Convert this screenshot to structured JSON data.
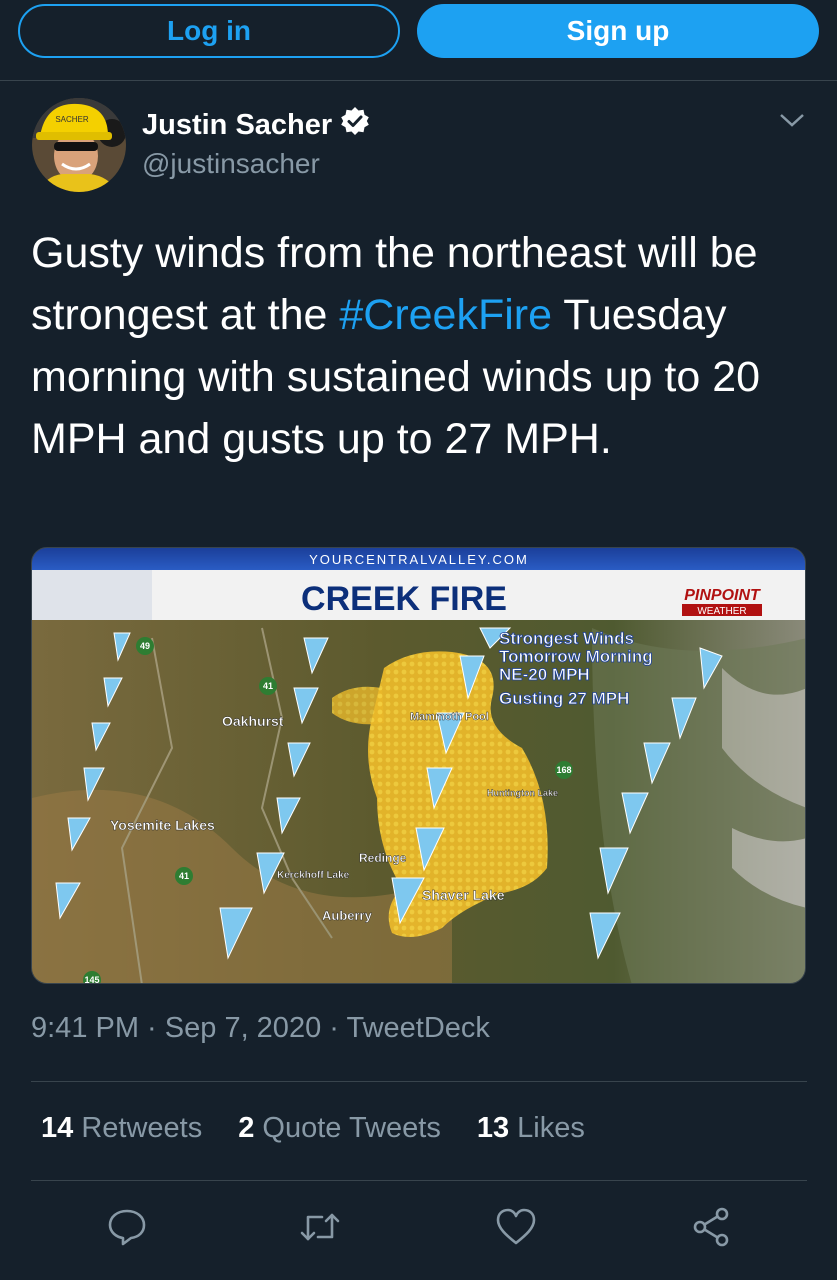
{
  "auth": {
    "login_label": "Log in",
    "signup_label": "Sign up"
  },
  "author": {
    "name": "Justin Sacher",
    "handle": "@justinsacher",
    "verified_icon": "verified-badge-icon",
    "avatar_helmet_text": "SACHER"
  },
  "tweet": {
    "text_before": "Gusty winds from the northeast will be strongest at the ",
    "hashtag": "#CreekFire",
    "text_after": " Tuesday morning with sustained winds up to 20 MPH and gusts up to 27 MPH."
  },
  "media": {
    "site": "YOURCENTRALVALLEY.COM",
    "title": "CREEK FIRE",
    "brand": "PINPOINT",
    "brand_sub": "WEATHER",
    "callout": [
      "Strongest Winds",
      "Tomorrow Morning",
      "NE-20 MPH",
      "Gusting 27 MPH"
    ],
    "places": {
      "oakhurst": "Oakhurst",
      "yosemite_lakes": "Yosemite Lakes",
      "kerckhoff": "Kerckhoff Lake",
      "auberry": "Auberry",
      "reding": "Redinge",
      "shaver": "Shaver Lake",
      "mammoth": "Mammoth Pool",
      "huntington": "Huntington Lake"
    },
    "shields": {
      "hwy49": "49",
      "hwy41a": "41",
      "hwy41b": "41",
      "hwy168": "168",
      "hwy145": "145"
    },
    "colors": {
      "fire": "#f2c230",
      "wind_arrow": "#7ec8ef",
      "terrain": "#6f6a3c"
    }
  },
  "meta": {
    "time": "9:41 PM",
    "sep1": " · ",
    "date": "Sep 7, 2020",
    "sep2": " · ",
    "source": "TweetDeck"
  },
  "stats": [
    {
      "count": "14",
      "label": "Retweets"
    },
    {
      "count": "2",
      "label": "Quote Tweets"
    },
    {
      "count": "13",
      "label": "Likes"
    }
  ],
  "actions": [
    "reply-icon",
    "retweet-icon",
    "like-icon",
    "share-icon"
  ]
}
